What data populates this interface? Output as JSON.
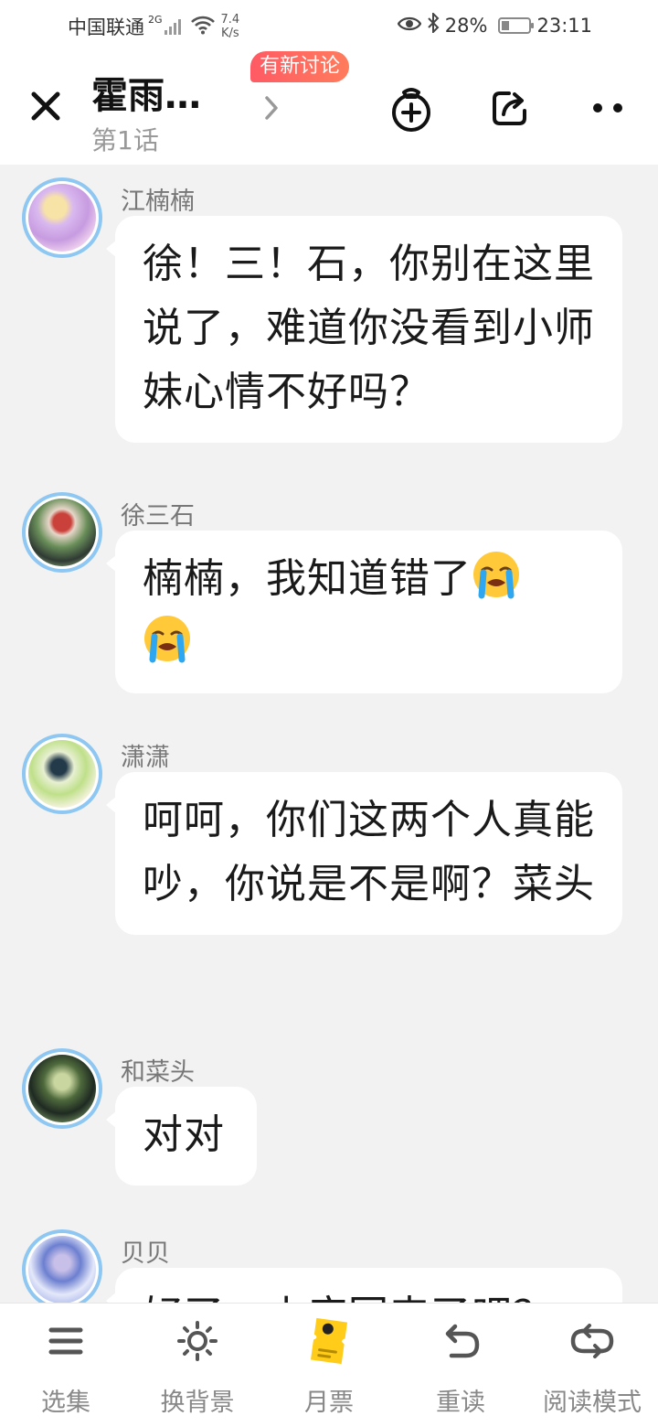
{
  "status_bar": {
    "carrier": "中国联通",
    "network": "2G",
    "speed": "7.4\nK/s",
    "battery": "28%",
    "battery_level": 0.28,
    "time": "23:11"
  },
  "header": {
    "title": "霍雨…",
    "chapter": "第1话",
    "badge": "有新讨论"
  },
  "messages": [
    {
      "name": "江楠楠",
      "text": "徐！三！石，你别在这里说了，难道你没看到小师妹心情不好吗？",
      "emoji_count": 0
    },
    {
      "name": "徐三石",
      "text": "楠楠，我知道错了",
      "emoji_count": 2,
      "emoji": "loudly-crying-face"
    },
    {
      "name": "潇潇",
      "text": "呵呵，你们这两个人真能吵，你说是不是啊？菜头",
      "emoji_count": 0
    },
    {
      "name": "和菜头",
      "text": "对对",
      "emoji_count": 0
    },
    {
      "name": "贝贝",
      "text": "好了，小庐回来了吧？",
      "emoji_count": 0
    }
  ],
  "bottom_tabs": [
    {
      "label": "选集",
      "icon": "menu-icon"
    },
    {
      "label": "换背景",
      "icon": "sun-icon"
    },
    {
      "label": "月票",
      "icon": "monthly-ticket-icon"
    },
    {
      "label": "重读",
      "icon": "reread-icon"
    },
    {
      "label": "阅读模式",
      "icon": "reading-mode-icon"
    }
  ],
  "colors": {
    "badge_gradient": [
      "#ff5a64",
      "#ff7c5c"
    ],
    "avatar_ring": "#8ec7f2",
    "ticket_yellow": "#ffcc1a"
  }
}
